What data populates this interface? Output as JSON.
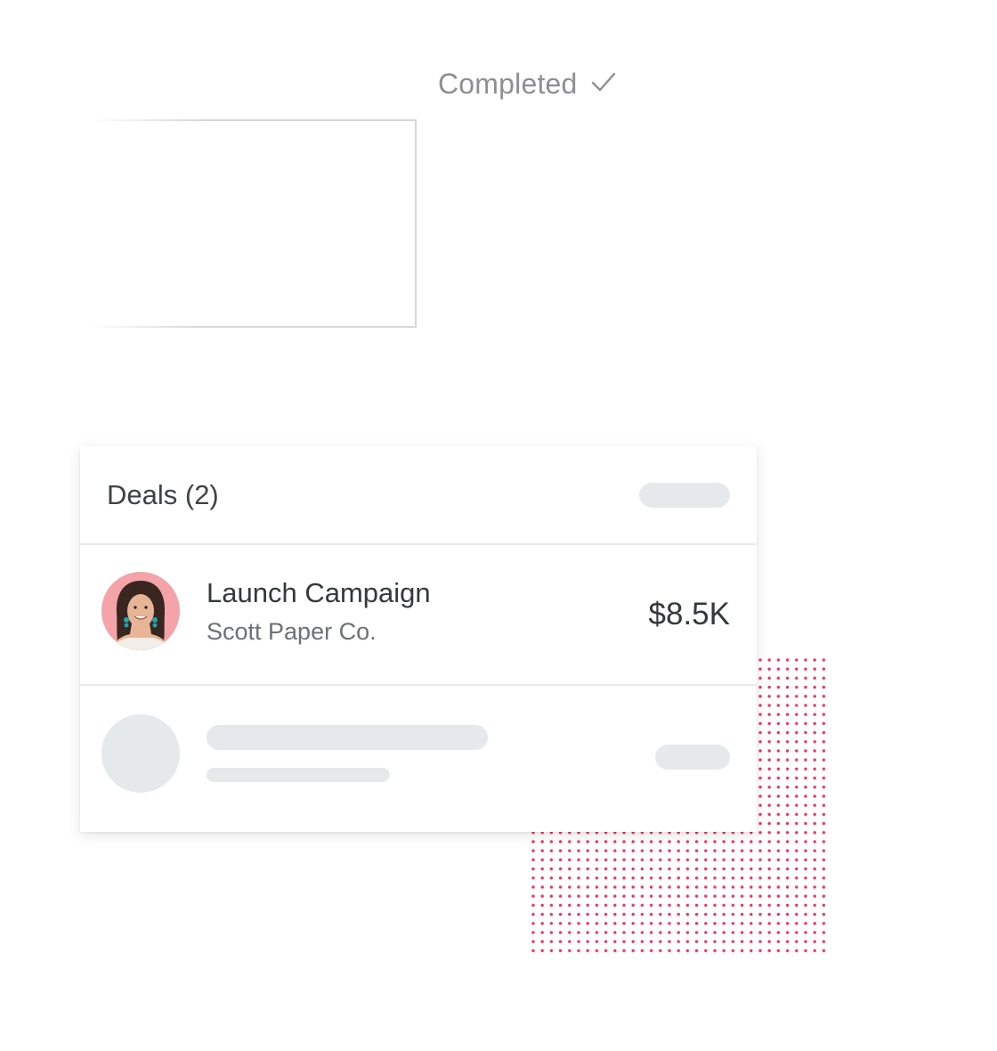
{
  "status": {
    "label": "Completed",
    "icon": "checkmark-icon"
  },
  "colors": {
    "dot_pattern": "#f0315f",
    "placeholder": "#e5e9ec",
    "divider": "#e6e8ea",
    "status_text": "#8d8f93",
    "avatar_background": "#f4a3a8"
  },
  "deals_card": {
    "title": "Deals (2)",
    "items": [
      {
        "name": "Launch Campaign",
        "company": "Scott Paper Co.",
        "amount": "$8.5K",
        "avatar_icon": "person-avatar"
      }
    ]
  }
}
